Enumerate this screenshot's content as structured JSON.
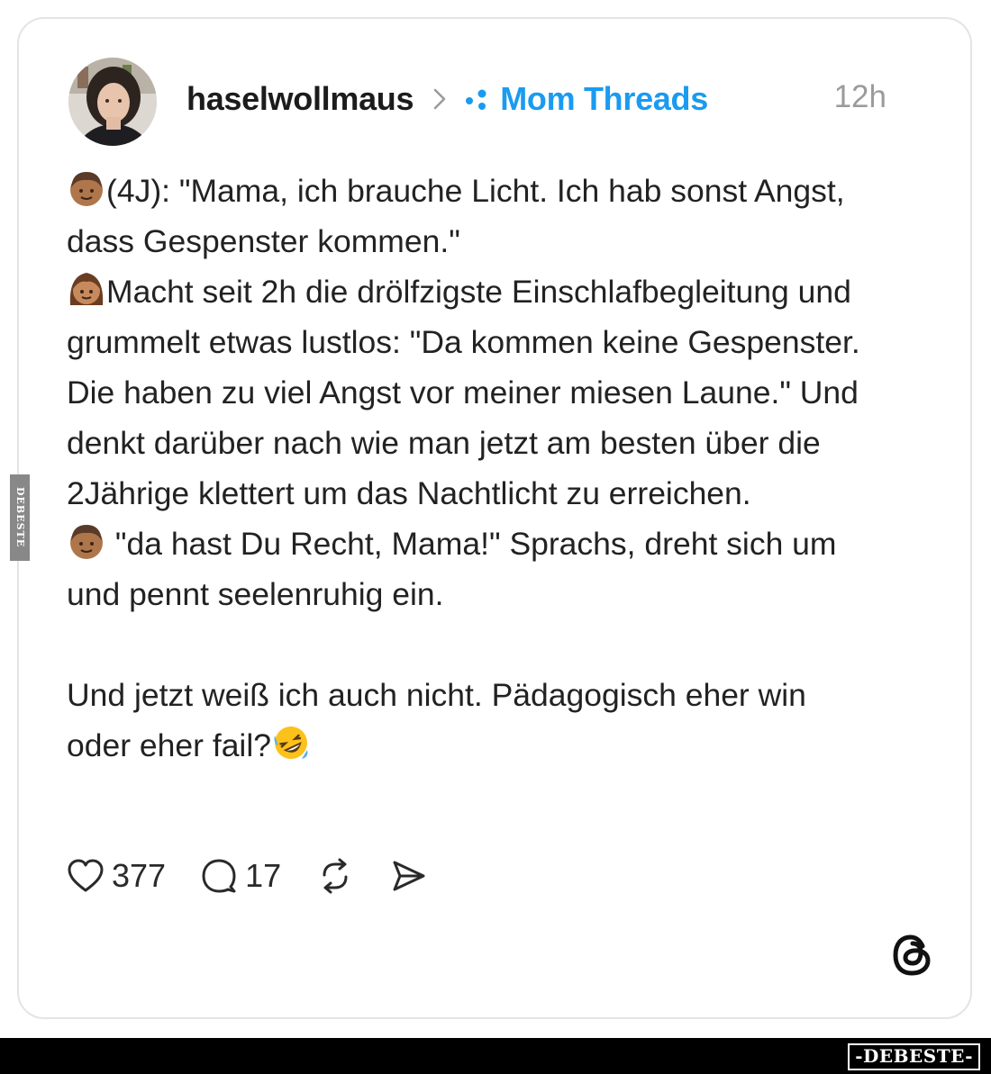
{
  "post": {
    "author": "haselwollmaus",
    "community": "Mom Threads",
    "time": "12h",
    "lines": {
      "l1": "(4J): \"Mama, ich brauche Licht. Ich hab sonst Angst, dass Gespenster kommen.\"",
      "l2": "Macht seit 2h die drölfzigste Einschlafbegleitung und grummelt etwas lustlos: \"Da kommen keine Gespenster. Die haben zu viel Angst vor meiner miesen Laune.\" Und denkt darüber nach wie man jetzt am besten über die 2Jährige klettert um das Nachtlicht zu erreichen.",
      "l3": " \"da hast Du Recht, Mama!\" Sprachs, dreht sich um und pennt seelenruhig ein.",
      "l4": "Und jetzt weiß ich auch nicht. Pädagogisch eher win oder eher fail?"
    },
    "emojis": {
      "boy": "boy-emoji",
      "woman": "woman-emoji",
      "laugh": "rolling-on-floor-laughing-emoji"
    }
  },
  "actions": {
    "likes": "377",
    "replies": "17",
    "icons": [
      "heart-icon",
      "comment-icon",
      "repost-icon",
      "share-icon"
    ]
  },
  "watermark": {
    "side": "DEBESTE",
    "footer": "-DEBESTE-"
  },
  "colors": {
    "accent": "#1a9bf0",
    "text": "#222222",
    "muted": "#9b9b9b",
    "border": "#e4e4e4"
  }
}
